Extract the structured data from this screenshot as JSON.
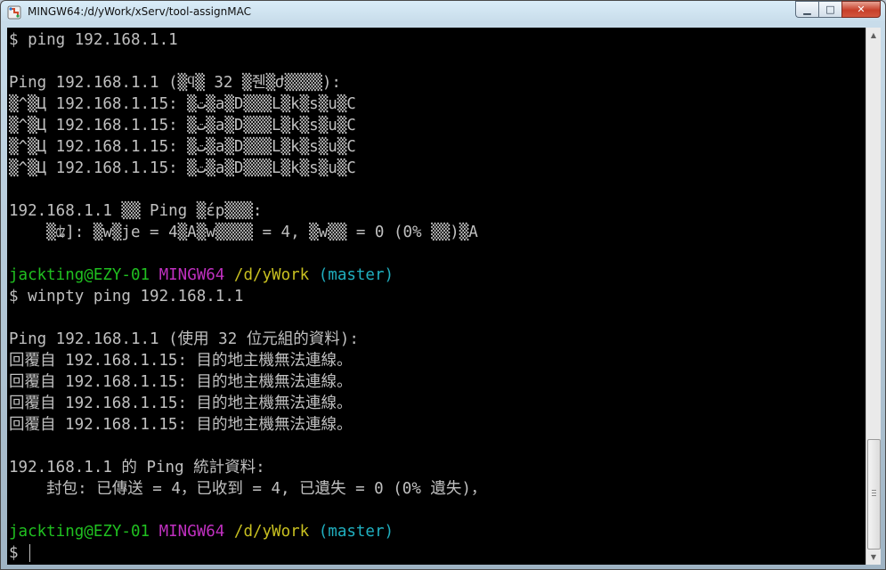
{
  "window": {
    "title": "MINGW64:/d/yWork/xServ/tool-assignMAC",
    "minimize_glyph": "▁",
    "maximize_glyph": "□",
    "close_glyph": "✕"
  },
  "terminal": {
    "lines": [
      [
        {
          "text": "$ ping 192.168.1.1",
          "color": "default"
        }
      ],
      [
        {
          "text": "",
          "color": "default"
        }
      ],
      [
        {
          "text": "Ping 192.168.1.1 (▒ϥ▒ 32 ▒줸▒ժ▒▒▒▒):",
          "color": "default"
        }
      ],
      [
        {
          "text": "▒^▒Ц 192.168.1.15: ▒ت▒a▒D▒▒▒L▒k▒s▒u▒C",
          "color": "default"
        }
      ],
      [
        {
          "text": "▒^▒Ц 192.168.1.15: ▒ت▒a▒D▒▒▒L▒k▒s▒u▒C",
          "color": "default"
        }
      ],
      [
        {
          "text": "▒^▒Ц 192.168.1.15: ▒ت▒a▒D▒▒▒L▒k▒s▒u▒C",
          "color": "default"
        }
      ],
      [
        {
          "text": "▒^▒Ц 192.168.1.15: ▒ت▒a▒D▒▒▒L▒k▒s▒u▒C",
          "color": "default"
        }
      ],
      [
        {
          "text": "",
          "color": "default"
        }
      ],
      [
        {
          "text": "192.168.1.1 ▒▒ Ping ▒έp▒▒▒:",
          "color": "default"
        }
      ],
      [
        {
          "text": "    ▒ʥ]: ▒w▒je = 4▒A▒w▒▒▒▒ = 4, ▒w▒▒ = 0 (0% ▒▒)▒A",
          "color": "default"
        }
      ],
      [
        {
          "text": "",
          "color": "default"
        }
      ],
      [
        {
          "text": "jackting@EZY-01",
          "color": "green"
        },
        {
          "text": " ",
          "color": "default"
        },
        {
          "text": "MINGW64",
          "color": "magenta"
        },
        {
          "text": " ",
          "color": "default"
        },
        {
          "text": "/d/yWork",
          "color": "yellow"
        },
        {
          "text": " ",
          "color": "default"
        },
        {
          "text": "(master)",
          "color": "cyan"
        }
      ],
      [
        {
          "text": "$ winpty ping 192.168.1.1",
          "color": "default"
        }
      ],
      [
        {
          "text": "",
          "color": "default"
        }
      ],
      [
        {
          "text": "Ping 192.168.1.1 (使用 32 位元組的資料):",
          "color": "default"
        }
      ],
      [
        {
          "text": "回覆自 192.168.1.15: 目的地主機無法連線。",
          "color": "default"
        }
      ],
      [
        {
          "text": "回覆自 192.168.1.15: 目的地主機無法連線。",
          "color": "default"
        }
      ],
      [
        {
          "text": "回覆自 192.168.1.15: 目的地主機無法連線。",
          "color": "default"
        }
      ],
      [
        {
          "text": "回覆自 192.168.1.15: 目的地主機無法連線。",
          "color": "default"
        }
      ],
      [
        {
          "text": "",
          "color": "default"
        }
      ],
      [
        {
          "text": "192.168.1.1 的 Ping 統計資料:",
          "color": "default"
        }
      ],
      [
        {
          "text": "    封包: 已傳送 = 4，已收到 = 4, 已遺失 = 0 (0% 遺失)，",
          "color": "default"
        }
      ],
      [
        {
          "text": "",
          "color": "default"
        }
      ],
      [
        {
          "text": "jackting@EZY-01",
          "color": "green"
        },
        {
          "text": " ",
          "color": "default"
        },
        {
          "text": "MINGW64",
          "color": "magenta"
        },
        {
          "text": " ",
          "color": "default"
        },
        {
          "text": "/d/yWork",
          "color": "yellow"
        },
        {
          "text": " ",
          "color": "default"
        },
        {
          "text": "(master)",
          "color": "cyan"
        }
      ],
      [
        {
          "text": "$ ",
          "color": "default"
        }
      ]
    ],
    "colors": {
      "default": "#c0c0c0",
      "green": "#20c020",
      "magenta": "#c030c0",
      "yellow": "#c8c020",
      "cyan": "#20b0c0",
      "background": "#000000"
    }
  },
  "scrollbar": {
    "up_glyph": "▲",
    "down_glyph": "▼"
  }
}
